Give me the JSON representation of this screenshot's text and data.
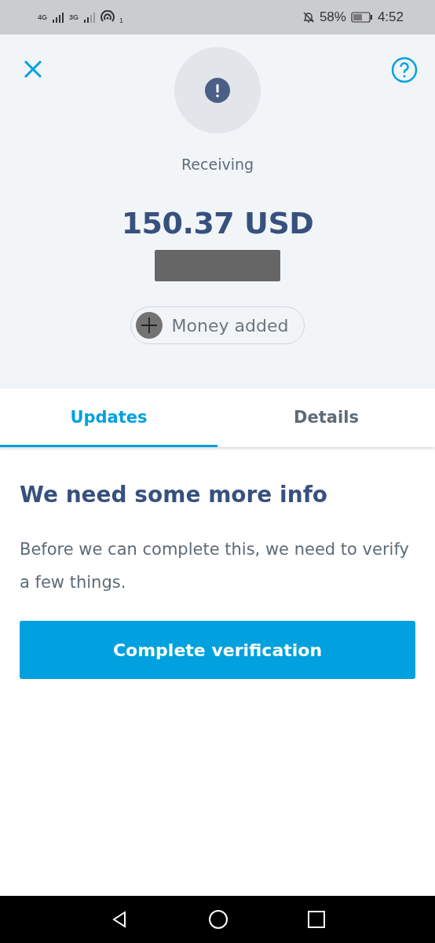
{
  "status_bar": {
    "network_1": "4G",
    "network_2": "3G",
    "hotspot_count": "1",
    "battery": "58%",
    "time": "4:52"
  },
  "header": {
    "status": "Receiving",
    "amount": "150.37 USD",
    "chip": "Money added"
  },
  "tabs": [
    {
      "label": "Updates",
      "selected": true
    },
    {
      "label": "Details",
      "selected": false
    }
  ],
  "content": {
    "heading": "We need some more info",
    "body": "Before we can complete this, we need to verify a few things.",
    "button": "Complete verification"
  }
}
